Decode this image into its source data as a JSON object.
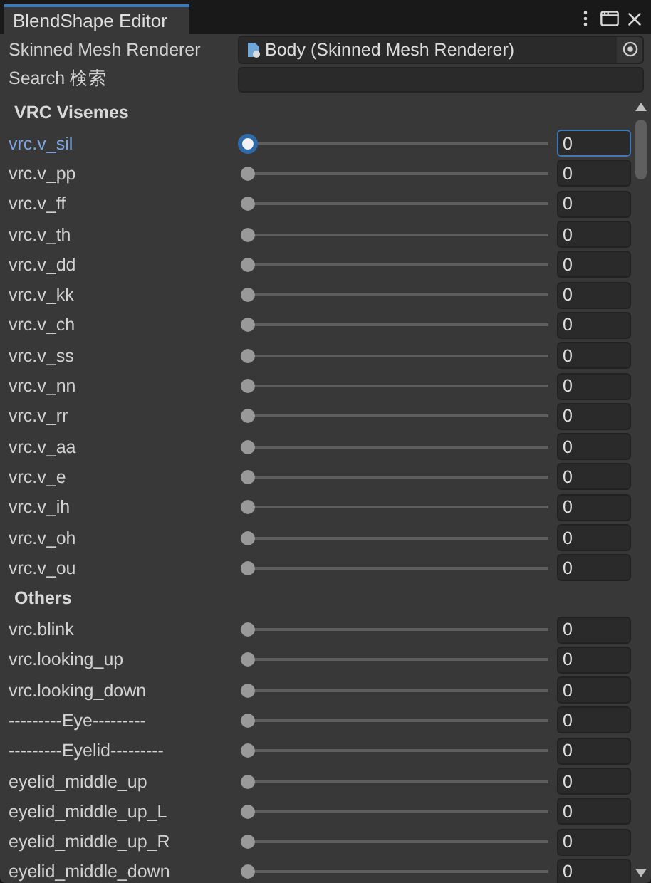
{
  "tab": {
    "title": "BlendShape Editor"
  },
  "properties": [
    {
      "kind": "object",
      "label": "Skinned Mesh Renderer",
      "value": "Body (Skinned Mesh Renderer)"
    },
    {
      "kind": "search",
      "label": "Search 検索"
    }
  ],
  "groups": [
    {
      "title": "VRC Visemes",
      "rows": [
        {
          "name": "vrc.v_sil",
          "level": 0,
          "value": "0",
          "selected": true
        },
        {
          "name": "vrc.v_pp",
          "level": 0,
          "value": "0",
          "selected": false
        },
        {
          "name": "vrc.v_ff",
          "level": 0,
          "value": "0",
          "selected": false
        },
        {
          "name": "vrc.v_th",
          "level": 0,
          "value": "0",
          "selected": false
        },
        {
          "name": "vrc.v_dd",
          "level": 0,
          "value": "0",
          "selected": false
        },
        {
          "name": "vrc.v_kk",
          "level": 0,
          "value": "0",
          "selected": false
        },
        {
          "name": "vrc.v_ch",
          "level": 0,
          "value": "0",
          "selected": false
        },
        {
          "name": "vrc.v_ss",
          "level": 0,
          "value": "0",
          "selected": false
        },
        {
          "name": "vrc.v_nn",
          "level": 0,
          "value": "0",
          "selected": false
        },
        {
          "name": "vrc.v_rr",
          "level": 0,
          "value": "0",
          "selected": false
        },
        {
          "name": "vrc.v_aa",
          "level": 0,
          "value": "0",
          "selected": false
        },
        {
          "name": "vrc.v_e",
          "level": 0,
          "value": "0",
          "selected": false
        },
        {
          "name": "vrc.v_ih",
          "level": 0,
          "value": "0",
          "selected": false
        },
        {
          "name": "vrc.v_oh",
          "level": 0,
          "value": "0",
          "selected": false
        },
        {
          "name": "vrc.v_ou",
          "level": 0,
          "value": "0",
          "selected": false
        }
      ]
    },
    {
      "title": "Others",
      "rows": [
        {
          "name": "vrc.blink",
          "level": 0,
          "value": "0",
          "selected": false
        },
        {
          "name": "vrc.looking_up",
          "level": 0,
          "value": "0",
          "selected": false
        },
        {
          "name": "vrc.looking_down",
          "level": 0,
          "value": "0",
          "selected": false
        },
        {
          "name": "---------Eye---------",
          "level": 0,
          "value": "0",
          "selected": false
        },
        {
          "name": "---------Eyelid---------",
          "level": 0,
          "value": "0",
          "selected": false
        },
        {
          "name": "eyelid_middle_up",
          "level": 0,
          "value": "0",
          "selected": false
        },
        {
          "name": "eyelid_middle_up_L",
          "level": 0,
          "value": "0",
          "selected": false
        },
        {
          "name": "eyelid_middle_up_R",
          "level": 0,
          "value": "0",
          "selected": false
        },
        {
          "name": "eyelid_middle_down",
          "level": 0,
          "value": "0",
          "selected": false
        }
      ]
    }
  ]
}
